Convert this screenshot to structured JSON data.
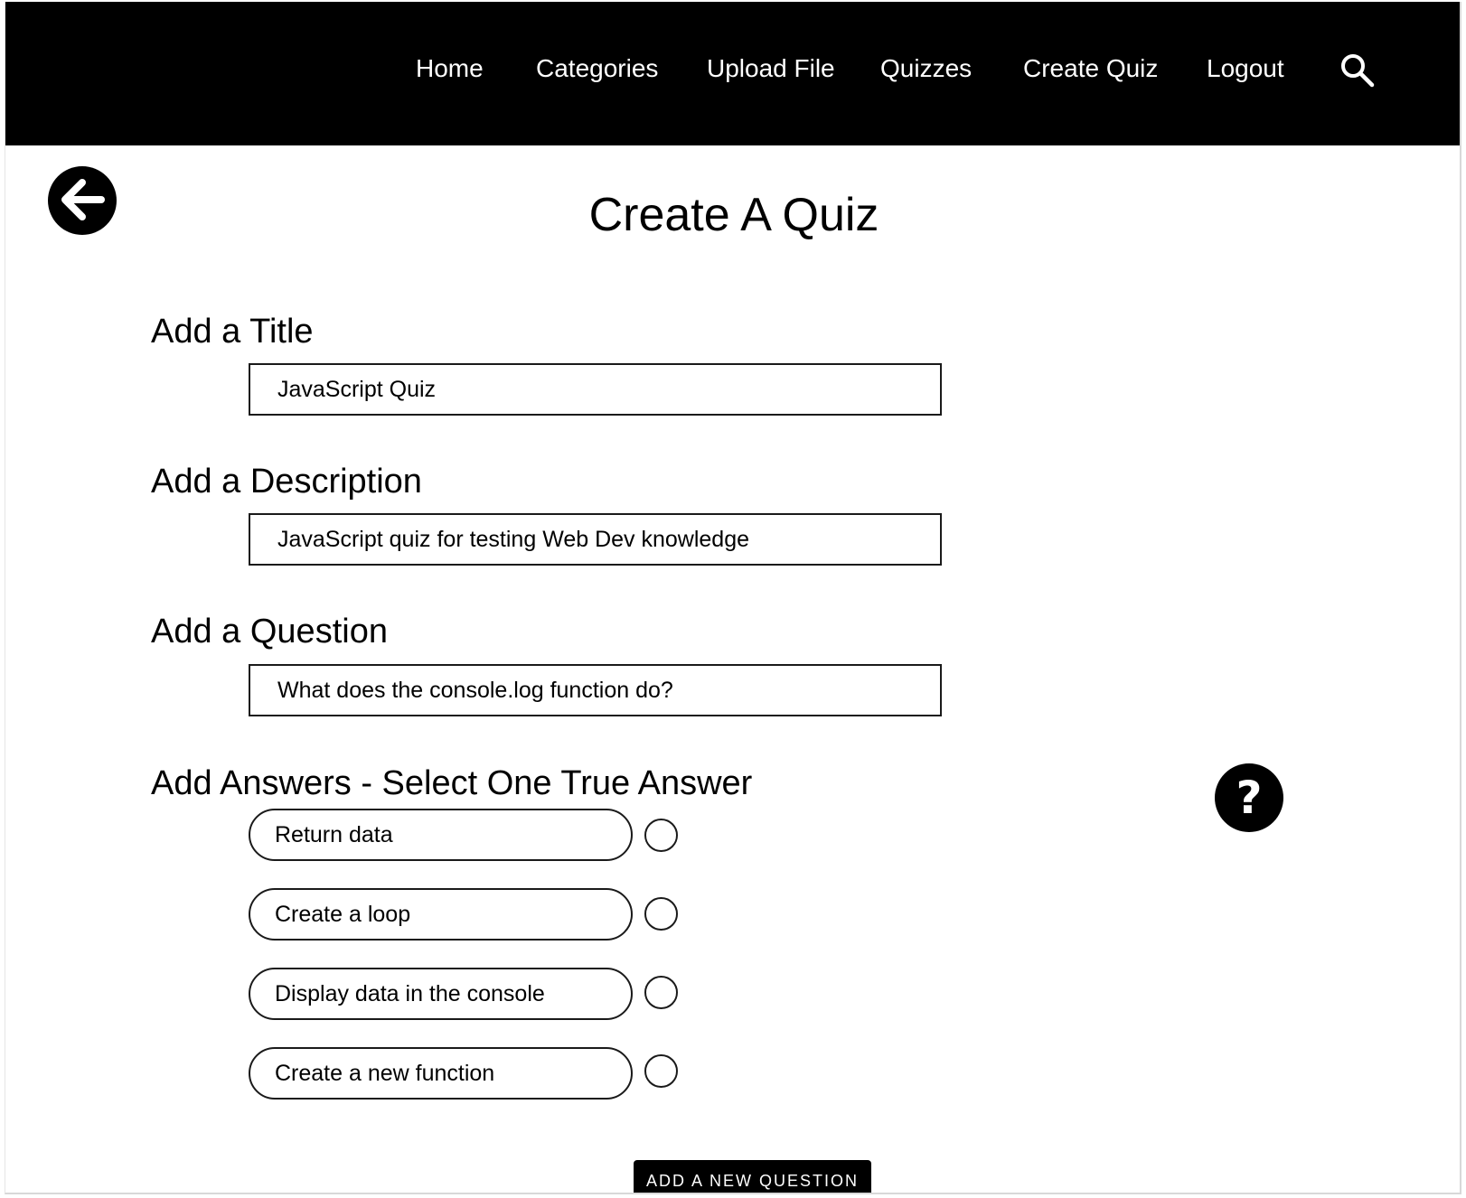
{
  "nav": {
    "items": [
      {
        "label": "Home"
      },
      {
        "label": "Categories"
      },
      {
        "label": "Upload File"
      },
      {
        "label": "Quizzes"
      },
      {
        "label": "Create Quiz"
      },
      {
        "label": "Logout"
      }
    ],
    "search_icon": "search-icon"
  },
  "back_icon": "arrow-left-circle-icon",
  "page_title": "Create A Quiz",
  "form": {
    "title_label": "Add a Title",
    "title_value": "JavaScript Quiz",
    "description_label": "Add a Description",
    "description_value": "JavaScript quiz for testing Web Dev knowledge",
    "question_label": "Add a Question",
    "question_value": "What does the console.log function do?",
    "answers_label": "Add Answers - Select One True Answer",
    "answers": [
      {
        "text": "Return data",
        "selected": false
      },
      {
        "text": "Create a loop",
        "selected": false
      },
      {
        "text": "Display data in the console",
        "selected": false
      },
      {
        "text": "Create a new function",
        "selected": false
      }
    ]
  },
  "help": {
    "label": "?",
    "icon": "question-mark-icon"
  },
  "add_question_button": "ADD A NEW QUESTION",
  "colors": {
    "nav_bg": "#000000",
    "nav_text": "#ffffff",
    "page_bg": "#ffffff"
  }
}
